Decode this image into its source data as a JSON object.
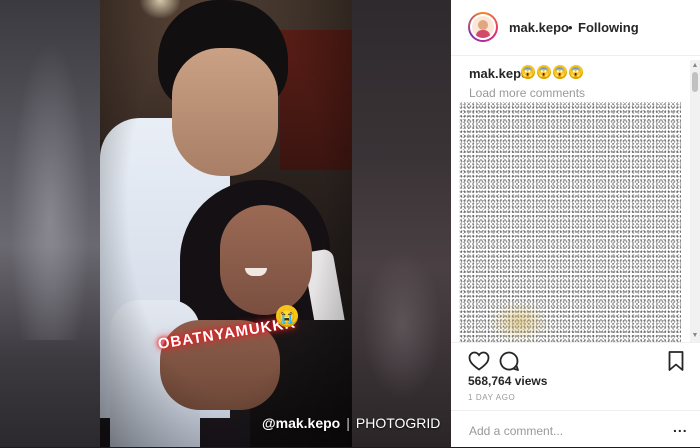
{
  "media": {
    "sticker_text": "OBATNYAMUKKK",
    "sticker_emoji": "😭",
    "watermark_handle": "@mak.kepo",
    "watermark_sep": "|",
    "watermark_brand": "PHOTOGRID"
  },
  "header": {
    "username": "mak.kepo",
    "dot": "•",
    "follow_status": "Following"
  },
  "caption": {
    "username": "mak.kepo",
    "emojis": [
      "😱",
      "😱",
      "😱",
      "😱"
    ]
  },
  "comments": {
    "load_more": "Load more comments"
  },
  "scrollbar": {
    "up_arrow": "▲",
    "down_arrow": "▼"
  },
  "post": {
    "views": "568,764 views",
    "time_ago": "1 DAY AGO"
  },
  "add_comment": {
    "placeholder": "Add a comment...",
    "more": "..."
  },
  "icons": {
    "like": "heart-icon",
    "comment": "comment-icon",
    "save": "bookmark-icon"
  }
}
